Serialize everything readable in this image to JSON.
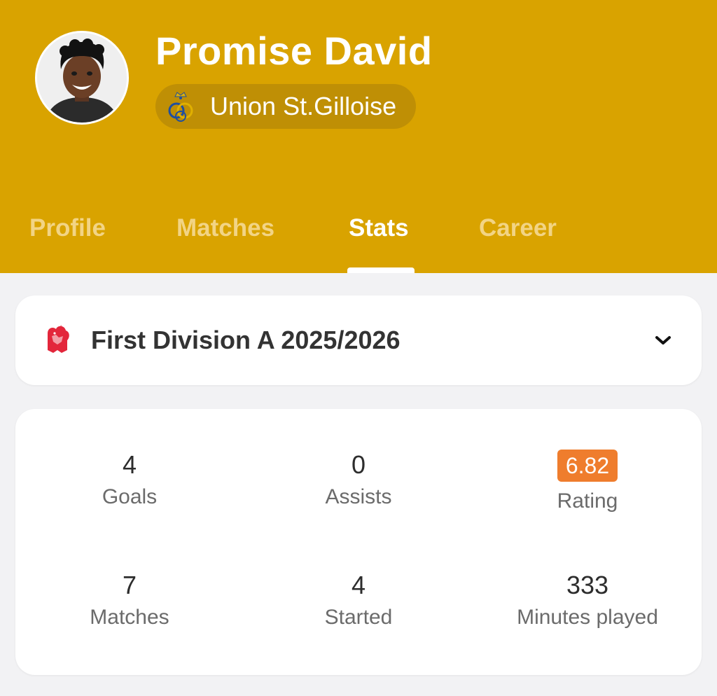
{
  "player": {
    "name": "Promise David",
    "team": "Union St.Gilloise"
  },
  "tabs": [
    {
      "label": "Profile",
      "active": false
    },
    {
      "label": "Matches",
      "active": false
    },
    {
      "label": "Stats",
      "active": true
    },
    {
      "label": "Career",
      "active": false
    }
  ],
  "competition": {
    "selected": "First Division A 2025/2026",
    "icon": "belgian-league-lion-icon"
  },
  "stats": {
    "goals": {
      "value": "4",
      "label": "Goals"
    },
    "assists": {
      "value": "0",
      "label": "Assists"
    },
    "rating": {
      "value": "6.82",
      "label": "Rating"
    },
    "matches": {
      "value": "7",
      "label": "Matches"
    },
    "started": {
      "value": "4",
      "label": "Started"
    },
    "minutes": {
      "value": "333",
      "label": "Minutes played"
    }
  },
  "colors": {
    "header": "#d9a300",
    "rating_badge": "#ef7d2d",
    "background": "#f2f2f4"
  }
}
